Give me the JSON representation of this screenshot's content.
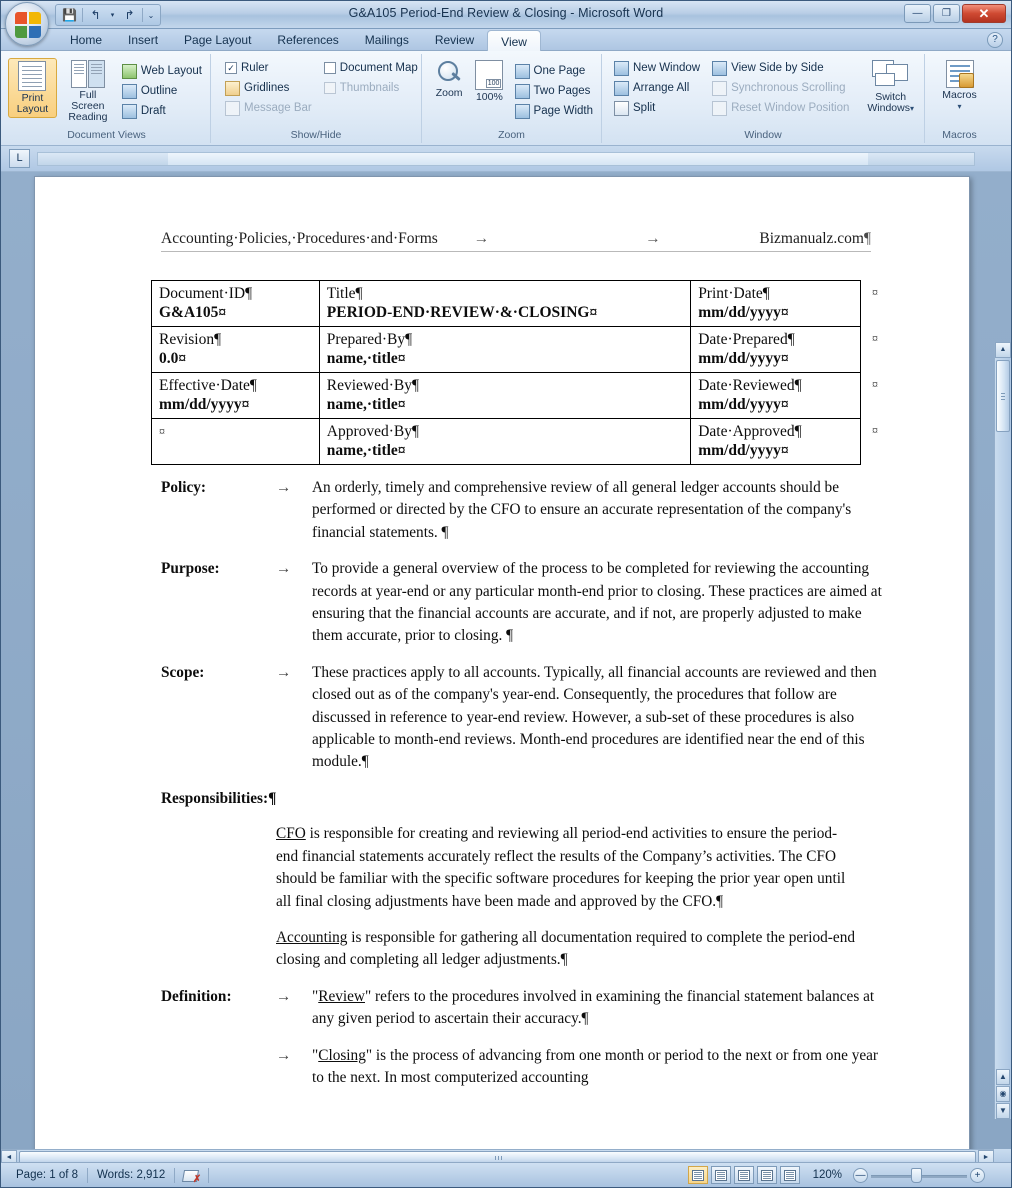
{
  "window": {
    "title": "G&A105 Period-End Review & Closing  -  Microsoft Word",
    "minimize_label": "—",
    "restore_label": "❐",
    "close_label": "✕"
  },
  "quick_access": {
    "save_label": "💾",
    "undo_label": "↰",
    "undo_dropdown_label": "▾",
    "redo_label": "↱",
    "customize_label": "⌄"
  },
  "help": {
    "label": "?"
  },
  "tabs": [
    {
      "label": "Home",
      "active": false
    },
    {
      "label": "Insert",
      "active": false
    },
    {
      "label": "Page Layout",
      "active": false
    },
    {
      "label": "References",
      "active": false
    },
    {
      "label": "Mailings",
      "active": false
    },
    {
      "label": "Review",
      "active": false
    },
    {
      "label": "View",
      "active": true
    }
  ],
  "ribbon": {
    "groups": [
      {
        "label": "Document Views"
      },
      {
        "label": "Show/Hide"
      },
      {
        "label": "Zoom"
      },
      {
        "label": "Window"
      },
      {
        "label": "Macros"
      }
    ],
    "document_views": {
      "print_layout": "Print\nLayout",
      "print_layout_l1": "Print",
      "print_layout_l2": "Layout",
      "full_screen_l1": "Full Screen",
      "full_screen_l2": "Reading",
      "web_layout": "Web Layout",
      "outline": "Outline",
      "draft": "Draft"
    },
    "show_hide": {
      "ruler": "Ruler",
      "ruler_checked": "✓",
      "gridlines": "Gridlines",
      "gridlines_checked": "",
      "message_bar": "Message Bar",
      "message_bar_checked": "",
      "document_map": "Document Map",
      "document_map_checked": "",
      "thumbnails": "Thumbnails",
      "thumbnails_checked": ""
    },
    "zoom": {
      "zoom": "Zoom",
      "one_hundred": "100%",
      "one_page": "One Page",
      "two_pages": "Two Pages",
      "page_width": "Page Width"
    },
    "window": {
      "new_window": "New Window",
      "arrange_all": "Arrange All",
      "split": "Split",
      "view_side_by_side": "View Side by Side",
      "synchronous_scrolling": "Synchronous Scrolling",
      "reset_window_position": "Reset Window Position",
      "switch_windows_l1": "Switch",
      "switch_windows_l2": "Windows",
      "switch_windows_caret": "▾"
    },
    "macros": {
      "label_l1": "Macros",
      "caret": "▾"
    }
  },
  "ruler": {
    "tab_selector": "L"
  },
  "document": {
    "header": {
      "left": "Accounting·Policies,·Procedures·and·Forms",
      "tab1": "→",
      "tab2": "→",
      "right": "Bizmanualz.com",
      "pilcrow": "¶"
    },
    "table": {
      "rows": [
        {
          "c1_label": "Document·ID¶",
          "c1_value": "G&A105¤",
          "c2_label": "Title¶",
          "c2_value": "PERIOD-END·REVIEW·&·CLOSING¤",
          "c3_label": "Print·Date¶",
          "c3_value": "mm/dd/yyyy¤",
          "endmark": "¤"
        },
        {
          "c1_label": "Revision¶",
          "c1_value": "0.0¤",
          "c2_label": "Prepared·By¶",
          "c2_value": "name,·title¤",
          "c3_label": "Date·Prepared¶",
          "c3_value": "mm/dd/yyyy¤",
          "endmark": "¤"
        },
        {
          "c1_label": "Effective·Date¶",
          "c1_value": "mm/dd/yyyy¤",
          "c2_label": "Reviewed·By¶",
          "c2_value": "name,·title¤",
          "c3_label": "Date·Reviewed¶",
          "c3_value": "mm/dd/yyyy¤",
          "endmark": "¤"
        },
        {
          "c1_label": "¤",
          "c1_value": "",
          "c2_label": "Approved·By¶",
          "c2_value": "name,·title¤",
          "c3_label": "Date·Approved¶",
          "c3_value": "mm/dd/yyyy¤",
          "endmark": "¤"
        }
      ]
    },
    "sections": {
      "policy_label": "Policy:",
      "policy_tab": "→",
      "policy_text": "An orderly, timely and comprehensive review of all general ledger accounts should be performed or directed by the CFO to ensure an accurate representation of the company's financial statements. ¶",
      "purpose_label": "Purpose:",
      "purpose_tab": "→",
      "purpose_text": "To provide a general overview of the process to be completed for reviewing the accounting records at year-end or any particular month-end prior to closing.  These practices are aimed at ensuring that the financial accounts are accurate, and if not, are properly adjusted to make them accurate, prior to closing. ¶",
      "scope_label": "Scope:",
      "scope_tab": "→",
      "scope_text": "These practices apply to all accounts.  Typically, all financial accounts are reviewed and then closed out as of the company's year-end.  Consequently, the procedures that follow are discussed in reference to year-end review.  However, a sub-set of these procedures is also applicable to month-end reviews.  Month-end procedures are identified near the end of this module.¶",
      "responsibilities_label": "Responsibilities:¶",
      "resp_cfo_term": "CFO",
      "resp_cfo_text": " is responsible for creating and reviewing all period-end activities to ensure the period-end financial statements accurately reflect the results of the Company’s activities.  The CFO should be familiar with the specific software procedures for keeping the prior year open until all final closing adjustments have been made and approved by the CFO.¶",
      "resp_acct_term": "Accounting",
      "resp_acct_text": " is responsible for gathering all documentation required to complete the period-end closing and completing all ledger adjustments.¶",
      "definition_label": "Definition:",
      "definition_tab": "→",
      "def1_term": "Review",
      "def1_text": "\" refers to the procedures involved in examining the financial statement balances at any given period to ascertain their accuracy.¶",
      "def1_open": "\"",
      "def2_tab": "→",
      "def2_open": "\"",
      "def2_term": "Closing",
      "def2_text": "\" is the process of advancing from one month or period to the next or from one year to the next.  In most computerized accounting"
    }
  },
  "scrollbars": {
    "up_arrow": "▲",
    "down_arrow": "▼",
    "left_arrow": "◄",
    "right_arrow": "►",
    "browse_prev": "▲",
    "browse_object": "◉",
    "browse_next": "▼"
  },
  "statusbar": {
    "page": "Page: 1 of 8",
    "words": "Words: 2,912",
    "proofing_tooltip": "",
    "zoom_value": "120%",
    "zoom_out": "—",
    "zoom_in": "+",
    "views": [
      {
        "name": "print-layout",
        "active": true
      },
      {
        "name": "full-screen-reading",
        "active": false
      },
      {
        "name": "web-layout",
        "active": false
      },
      {
        "name": "outline",
        "active": false
      },
      {
        "name": "draft",
        "active": false
      }
    ]
  }
}
